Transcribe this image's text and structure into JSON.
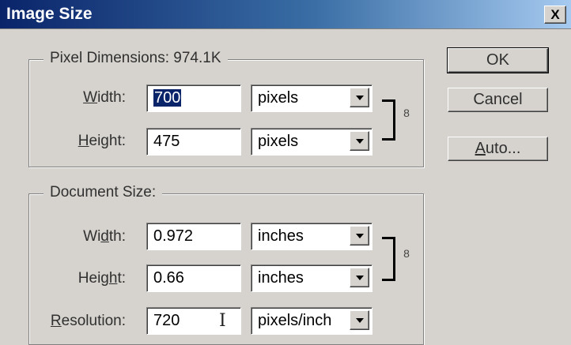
{
  "window": {
    "title": "Image Size",
    "close_label": "X"
  },
  "pixel_dimensions": {
    "title": "Pixel Dimensions:  974.1K",
    "width_label_pre": "",
    "width_label_ul": "W",
    "width_label_post": "idth:",
    "width_value": "700",
    "width_unit": "pixels",
    "height_label_ul": "H",
    "height_label_post": "eight:",
    "height_value": "475",
    "height_unit": "pixels"
  },
  "document_size": {
    "title": "Document Size:",
    "width_label_pre": "Wi",
    "width_label_ul": "d",
    "width_label_post": "th:",
    "width_value": "0.972",
    "width_unit": "inches",
    "height_label_pre": "Heig",
    "height_label_ul": "h",
    "height_label_post": "t:",
    "height_value": "0.66",
    "height_unit": "inches",
    "resolution_label_ul": "R",
    "resolution_label_post": "esolution:",
    "resolution_value": "720",
    "resolution_unit": "pixels/inch"
  },
  "buttons": {
    "ok": "OK",
    "cancel": "Cancel",
    "auto_ul": "A",
    "auto_post": "uto..."
  },
  "icons": {
    "link": "chain-link-icon",
    "text_cursor": "I"
  }
}
